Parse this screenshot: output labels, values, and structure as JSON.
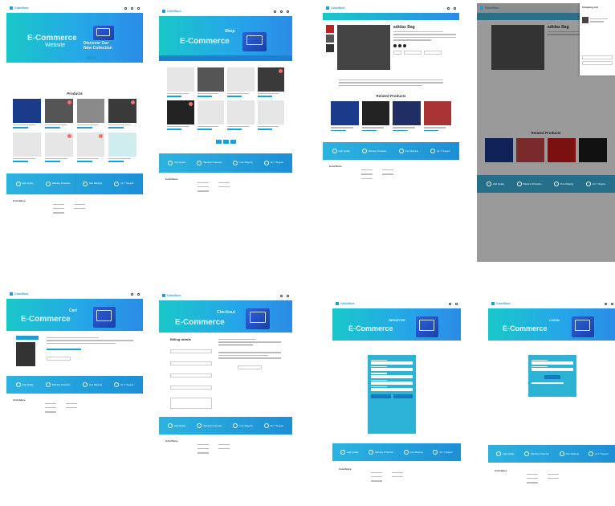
{
  "brand": "ColorStore",
  "hero_word": "E-Commerce",
  "p1": {
    "hero_sub": "Website",
    "promo": "Discover Our New Collection",
    "shop_btn": "",
    "products_title": "Products",
    "products": [
      "",
      "",
      "",
      "",
      "",
      "",
      "",
      ""
    ]
  },
  "p2": {
    "hero_tag": "Shop",
    "pages": [
      "1",
      "2",
      "3"
    ]
  },
  "p3": {
    "product_title": "adidas Bag",
    "related_title": "Related Products"
  },
  "p4": {
    "product_title": "adidas Bag",
    "related_title": "Related Products",
    "drawer_title": "Shopping cart"
  },
  "p5": {
    "hero_tag": "Cart"
  },
  "p6": {
    "hero_tag": "Checkout",
    "form_title": "Billing details"
  },
  "p7": {
    "hero_tag": "REGISTER"
  },
  "p8": {
    "hero_tag": "LOGIN"
  },
  "features": [
    "High Quality",
    "Warranty Protection",
    "Free Shipping",
    "24 / 7 Support"
  ],
  "footer_brand": "ColorStore",
  "colors": {
    "accent": "#1b9fd6",
    "hero_from": "#19c8c9",
    "hero_to": "#2b8ce6",
    "badge": "#ff6b6b"
  }
}
